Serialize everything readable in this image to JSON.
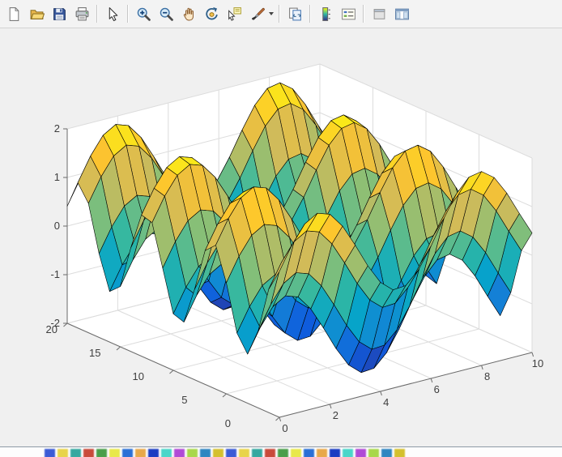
{
  "figure": {
    "background": "#f0f0f0"
  },
  "toolbar": {
    "background": "#f3f3f3",
    "items": [
      {
        "name": "new-figure-button",
        "icon": "new-document-icon"
      },
      {
        "name": "open-file-button",
        "icon": "open-folder-icon"
      },
      {
        "name": "save-figure-button",
        "icon": "save-icon"
      },
      {
        "name": "print-figure-button",
        "icon": "printer-icon"
      },
      {
        "sep": true
      },
      {
        "name": "edit-plot-button",
        "icon": "arrow-cursor-icon"
      },
      {
        "sep": true
      },
      {
        "name": "zoom-in-button",
        "icon": "zoom-in-icon"
      },
      {
        "name": "zoom-out-button",
        "icon": "zoom-out-icon"
      },
      {
        "name": "pan-button",
        "icon": "hand-icon"
      },
      {
        "name": "rotate-3d-button",
        "icon": "rotate-3d-icon"
      },
      {
        "name": "data-cursor-button",
        "icon": "data-cursor-icon"
      },
      {
        "name": "brush-button",
        "icon": "brush-icon",
        "dropdown": true
      },
      {
        "sep": true
      },
      {
        "name": "link-plot-button",
        "icon": "link-plot-icon"
      },
      {
        "sep": true
      },
      {
        "name": "insert-colorbar-button",
        "icon": "colorbar-icon"
      },
      {
        "name": "insert-legend-button",
        "icon": "legend-icon"
      },
      {
        "sep": true
      },
      {
        "name": "hide-plot-tools-button",
        "icon": "hide-plot-tools-icon"
      },
      {
        "name": "show-plot-tools-button",
        "icon": "show-plot-tools-icon"
      }
    ]
  },
  "chart_data": {
    "type": "surface",
    "title": "",
    "formula_js": "Math.sin(x)+Math.cos(y)",
    "x_range": [
      0,
      10
    ],
    "y_range": [
      0,
      20
    ],
    "z_range": [
      -2,
      2
    ],
    "x_step": 0.5,
    "y_step": 1,
    "x_ticks": [
      0,
      2,
      4,
      6,
      8,
      10
    ],
    "y_ticks": [
      0,
      5,
      10,
      15,
      20
    ],
    "z_ticks": [
      -2,
      -1,
      0,
      1,
      2
    ],
    "view": {
      "azimuth": -37.5,
      "elevation": 30
    },
    "colormap": "parula",
    "colormap_stops": [
      [
        0,
        "#352a87"
      ],
      [
        0.125,
        "#0f5cdd"
      ],
      [
        0.25,
        "#1481d6"
      ],
      [
        0.375,
        "#06a4ca"
      ],
      [
        0.5,
        "#2eb7a4"
      ],
      [
        0.625,
        "#87bf77"
      ],
      [
        0.75,
        "#d1bb59"
      ],
      [
        0.875,
        "#fdc32f"
      ],
      [
        1,
        "#f9fb0e"
      ]
    ],
    "edge_color": "#000000",
    "wall_color": "#ffffff",
    "grid_color": "#dcdcdc",
    "axis_color": "#6a6a6a",
    "label_color": "#3d3d3d",
    "grid": true,
    "legend": false
  },
  "background_sliver": {
    "colors": [
      "#3b5bd6",
      "#e8d44a",
      "#35a8a0",
      "#c94a3a",
      "#4a9e4a",
      "#e8e84a",
      "#2a6fd6",
      "#e8a84a",
      "#1b3cc2",
      "#4ad6c9",
      "#b04ad6",
      "#a8d84a",
      "#2e86c1",
      "#d4c02e"
    ]
  }
}
